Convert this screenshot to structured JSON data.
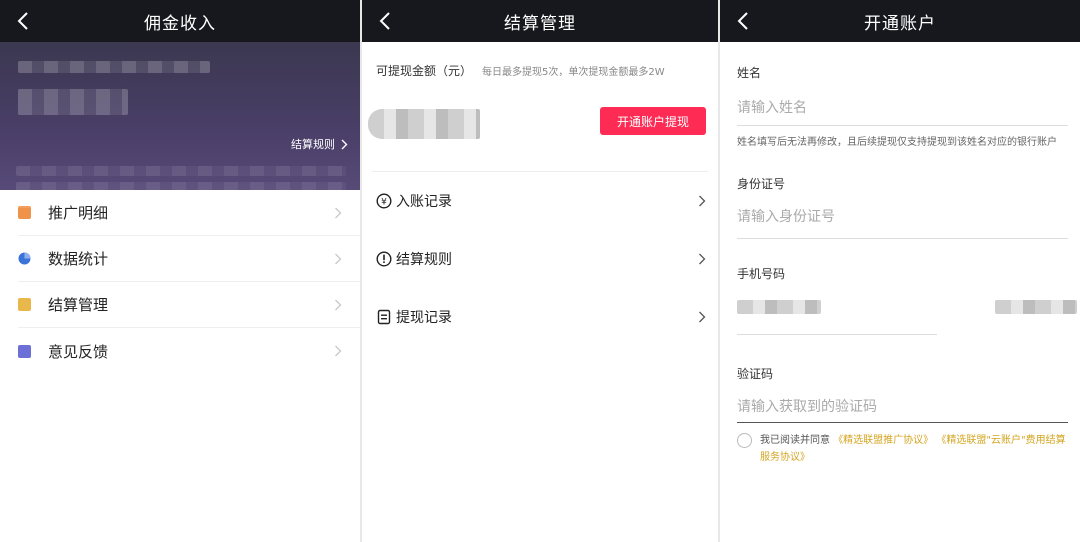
{
  "commission": {
    "title": "佣金收入",
    "rules_label": "结算规则",
    "menu": [
      {
        "label": "推广明细",
        "icon": "doc-icon",
        "color": "#f0934a"
      },
      {
        "label": "数据统计",
        "icon": "pie-chart-icon",
        "color": "#3b74d9"
      },
      {
        "label": "结算管理",
        "icon": "settlement-icon",
        "color": "#e8b84a"
      },
      {
        "label": "意见反馈",
        "icon": "feedback-icon",
        "color": "#6b6fd6"
      }
    ]
  },
  "settlement": {
    "title": "结算管理",
    "withdraw_title": "可提现金额（元）",
    "withdraw_tip": "每日最多提现5次，单次提现金额最多2W",
    "open_button": "开通账户提现",
    "items": [
      {
        "label": "入账记录",
        "icon": "yen-icon"
      },
      {
        "label": "结算规则",
        "icon": "exclamation-icon"
      },
      {
        "label": "提现记录",
        "icon": "list-icon"
      }
    ]
  },
  "account": {
    "title": "开通账户",
    "name_label": "姓名",
    "name_placeholder": "请输入姓名",
    "name_hint": "姓名填写后无法再修改，且后续提现仅支持提现到该姓名对应的银行账户",
    "id_label": "身份证号",
    "id_placeholder": "请输入身份证号",
    "phone_label": "手机号码",
    "code_label": "验证码",
    "code_placeholder": "请输入获取到的验证码",
    "agree_prefix": "我已阅读并同意",
    "agree_link1": "《精选联盟推广协议》",
    "agree_link2": "《精选联盟\"云账户\"费用结算服务协议》"
  },
  "colors": {
    "navbar": "#17181d",
    "accent": "#fe2c55",
    "link": "#d5a521"
  }
}
